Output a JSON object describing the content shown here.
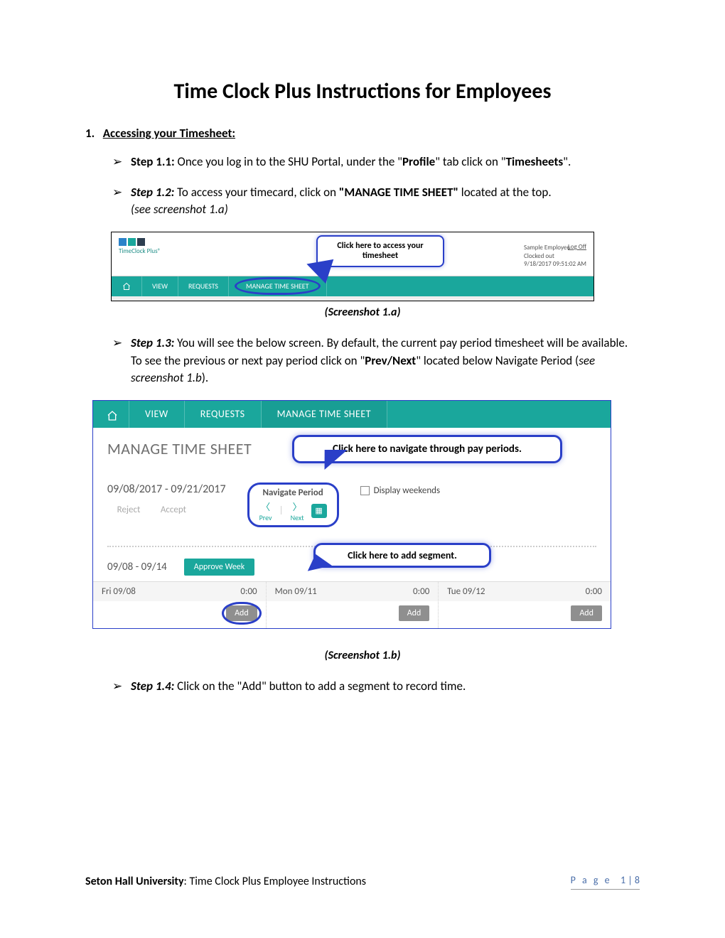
{
  "title": "Time Clock Plus Instructions for Employees",
  "section1": {
    "num": "1.",
    "heading": "Accessing your Timesheet:"
  },
  "steps": {
    "s11": {
      "label": "Step 1.1:",
      "t1": " Once you log in to the SHU Portal, under the \"",
      "b1": "Profile",
      "t2": "\" tab click on \"",
      "b2": "Timesheets",
      "t3": "\"."
    },
    "s12": {
      "label": "Step 1.2:",
      "t1": " To access your timecard, click on ",
      "b1": "\"MANAGE TIME SHEET\"",
      "t2": " located at the top. ",
      "see": "(see screenshot 1.a)"
    },
    "s13": {
      "label": "Step 1.3:",
      "t1": " You will see the below screen. By default, the current pay period timesheet will be available. To see the previous or next pay period click on \"",
      "b1": "Prev/Next",
      "t2": "\" located below Navigate Period (",
      "see": "see screenshot 1.b",
      "t3": ")."
    },
    "s14": {
      "label": "Step 1.4:",
      "t1": " Click on the \"Add\" button to add a segment to record time."
    }
  },
  "shot1a": {
    "logo": "TimeClock Plus®",
    "callout": "Click here to access your timesheet",
    "user": {
      "name": "Sample Employee",
      "status": "Clocked out",
      "ts": "9/18/2017  09:51:02 AM",
      "logoff": "Log Off"
    },
    "nav": {
      "view": "VIEW",
      "requests": "REQUESTS",
      "mts": "MANAGE  TIME  SHEET"
    },
    "caption": "(Screenshot 1.a)"
  },
  "shot1b": {
    "nav": {
      "view": "VIEW",
      "requests": "REQUESTS",
      "mts": "MANAGE  TIME  SHEET"
    },
    "heading": "MANAGE TIME SHEET",
    "callout_nav": "Click here to navigate through pay periods.",
    "period": "09/08/2017 - 09/21/2017",
    "reject": "Reject",
    "accept": "Accept",
    "navper": {
      "title": "Navigate Period",
      "prev": "Prev",
      "next": "Next"
    },
    "display_weekends": "Display weekends",
    "callout_add": "Click here to add segment.",
    "week_range": "09/08 - 09/14",
    "approve": "Approve Week",
    "days": [
      {
        "label": "Fri 09/08",
        "hours": "0:00",
        "add": "Add"
      },
      {
        "label": "Mon 09/11",
        "hours": "0:00",
        "add": "Add"
      },
      {
        "label": "Tue 09/12",
        "hours": "0:00",
        "add": "Add"
      }
    ],
    "caption": "(Screenshot 1.b)"
  },
  "footer": {
    "left_b": "Seton Hall University",
    "left": ": Time Clock Plus Employee Instructions",
    "page_word": "P a g e",
    "pg": "1",
    "sep": " | ",
    "total": "8"
  }
}
